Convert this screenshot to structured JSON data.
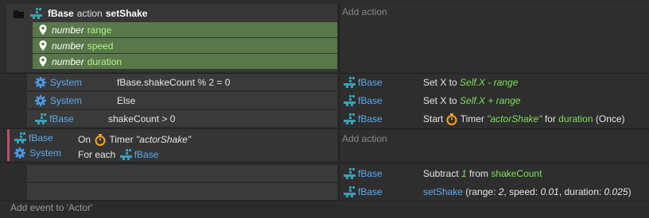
{
  "colors": {
    "param_bg": "#58784a",
    "accent_blue": "#5aaaf0",
    "value_green": "#7ee05a",
    "timer_orange": "#f5a623"
  },
  "function_block": {
    "object": "fBase",
    "keyword": "action",
    "name": "setShake",
    "params": [
      {
        "type": "number",
        "name": "range"
      },
      {
        "type": "number",
        "name": "speed"
      },
      {
        "type": "number",
        "name": "duration"
      }
    ],
    "add_action": "Add action"
  },
  "event1": {
    "conditions": [
      {
        "object": "System",
        "text": "fBase.shakeCount % 2 = 0"
      },
      {
        "object": "System",
        "text": "Else"
      },
      {
        "object": "fBase",
        "text": "shakeCount > 0"
      }
    ],
    "actions": [
      {
        "object": "fBase",
        "verb": "Set X to ",
        "expr": "Self.X - range"
      },
      {
        "object": "fBase",
        "verb": "Set X to ",
        "expr": "Self.X + range"
      },
      {
        "object": "fBase",
        "start": "Start ",
        "timer": "Timer ",
        "tag": "\"actorShake\"",
        "for": " for ",
        "var": "duration",
        "once": " (Once)"
      }
    ]
  },
  "event2": {
    "objects": [
      "fBase",
      "System"
    ],
    "on_text": "On ",
    "timer_text": "Timer ",
    "tag": "\"actorShake\"",
    "foreach_text": "For each ",
    "foreach_object": "fBase",
    "add_action": "Add action",
    "actions": [
      {
        "object": "fBase",
        "verb": "Subtract ",
        "num": "1",
        "from": " from ",
        "var": "shakeCount"
      },
      {
        "object": "fBase",
        "call": "setShake",
        "args_open": " (range: ",
        "a1": "2",
        "sep1": ", speed: ",
        "a2": "0.01",
        "sep2": ", duration: ",
        "a3": "0.025",
        "close": ")"
      }
    ]
  },
  "footer": {
    "add_event": "Add event to 'Actor'"
  }
}
